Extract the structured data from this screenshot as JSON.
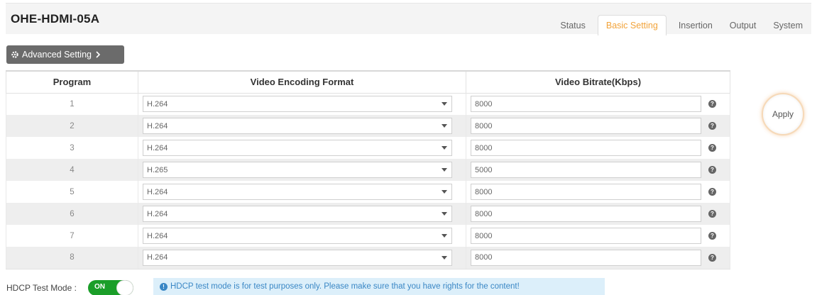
{
  "app": {
    "title": "OHE-HDMI-05A"
  },
  "tabs": [
    {
      "label": "Status",
      "active": false
    },
    {
      "label": "Basic Setting",
      "active": true
    },
    {
      "label": "Insertion",
      "active": false
    },
    {
      "label": "Output",
      "active": false
    },
    {
      "label": "System",
      "active": false
    }
  ],
  "advanced": {
    "label": "Advanced Setting",
    "icon": "gear-icon",
    "chevron": "chevron-right-icon"
  },
  "table": {
    "headers": {
      "program": "Program",
      "format": "Video Encoding Format",
      "bitrate": "Video Bitrate(Kbps)"
    },
    "rows": [
      {
        "program": "1",
        "format": "H.264",
        "bitrate": "8000"
      },
      {
        "program": "2",
        "format": "H.264",
        "bitrate": "8000"
      },
      {
        "program": "3",
        "format": "H.264",
        "bitrate": "8000"
      },
      {
        "program": "4",
        "format": "H.265",
        "bitrate": "5000"
      },
      {
        "program": "5",
        "format": "H.264",
        "bitrate": "8000"
      },
      {
        "program": "6",
        "format": "H.264",
        "bitrate": "8000"
      },
      {
        "program": "7",
        "format": "H.264",
        "bitrate": "8000"
      },
      {
        "program": "8",
        "format": "H.264",
        "bitrate": "8000"
      }
    ]
  },
  "apply": {
    "label": "Apply"
  },
  "hdcp": {
    "label": "HDCP Test Mode :",
    "toggle_text": "ON",
    "enabled": true
  },
  "notice": {
    "text": "HDCP test mode is for test purposes only. Please make sure that you have rights for the content!"
  },
  "colors": {
    "accent": "#f2a33a",
    "toggle_on": "#1b9e29",
    "notice_bg": "#dceffa",
    "notice_text": "#3a87c5"
  }
}
